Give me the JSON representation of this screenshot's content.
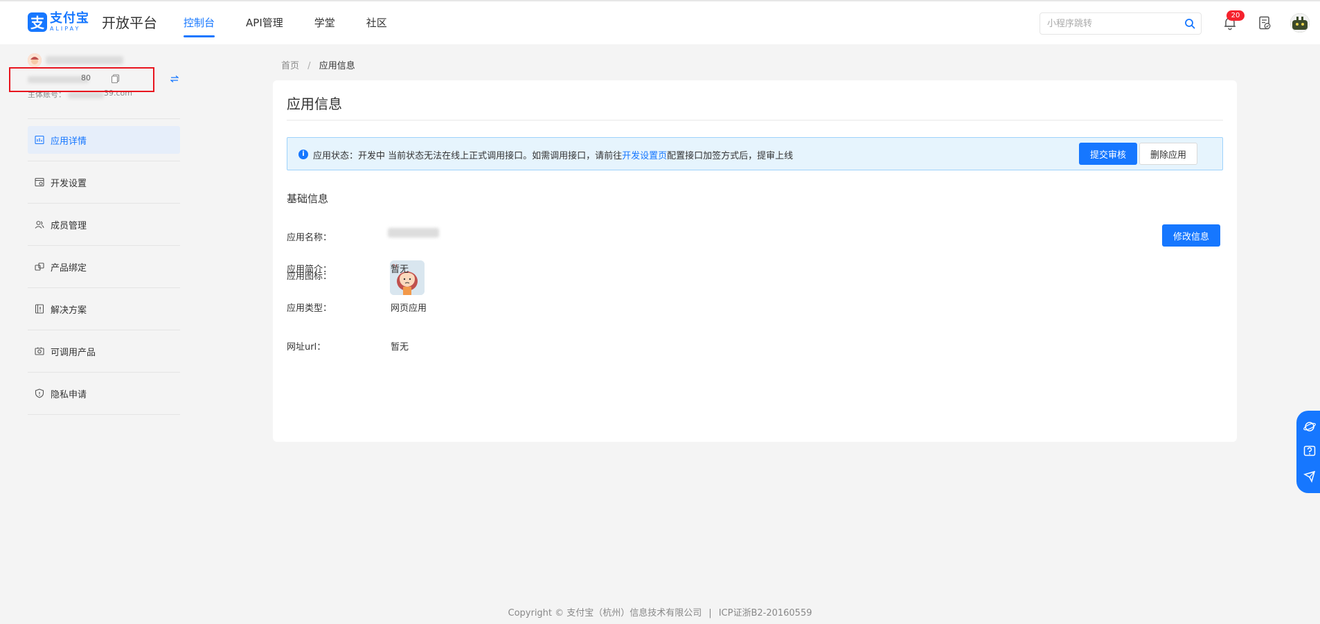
{
  "header": {
    "logo_cn": "支付宝",
    "logo_en": "ALIPAY",
    "platform_name": "开放平台",
    "nav": [
      {
        "label": "控制台",
        "active": true
      },
      {
        "label": "API管理",
        "active": false
      },
      {
        "label": "学堂",
        "active": false
      },
      {
        "label": "社区",
        "active": false
      }
    ],
    "search_placeholder": "小程序跳转",
    "notification_count": "20"
  },
  "sidebar": {
    "app_id_tail": "80",
    "owner_label": "主体账号：",
    "owner_tail": "39.com",
    "menu": [
      {
        "label": "应用详情",
        "icon": "app-detail-icon",
        "active": true
      },
      {
        "label": "开发设置",
        "icon": "dev-settings-icon",
        "active": false
      },
      {
        "label": "成员管理",
        "icon": "members-icon",
        "active": false
      },
      {
        "label": "产品绑定",
        "icon": "product-bind-icon",
        "active": false
      },
      {
        "label": "解决方案",
        "icon": "solution-icon",
        "active": false
      },
      {
        "label": "可调用产品",
        "icon": "callable-products-icon",
        "active": false
      },
      {
        "label": "隐私申请",
        "icon": "privacy-icon",
        "active": false
      }
    ]
  },
  "breadcrumb": {
    "home": "首页",
    "separator": "/",
    "current": "应用信息"
  },
  "card": {
    "title": "应用信息",
    "alert": {
      "prefix": "应用状态：开发中 当前状态无法在线上正式调用接口。如需调用接口，请前往",
      "link": "开发设置页",
      "suffix": "配置接口加签方式后，提审上线"
    },
    "submit_button": "提交审核",
    "delete_button": "删除应用",
    "section_title": "基础信息",
    "edit_button": "修改信息",
    "fields": {
      "name_label": "应用名称：",
      "icon_label": "应用图标：",
      "intro_label": "应用简介：",
      "intro_value": "暂无",
      "type_label": "应用类型：",
      "type_value": "网页应用",
      "url_label": "网址url：",
      "url_value": "暂无"
    }
  },
  "footer": {
    "copyright": "Copyright © 支付宝（杭州）信息技术有限公司",
    "separator": "|",
    "icp": "ICP证浙B2-20160559"
  },
  "colors": {
    "brand": "#1677ff",
    "alert_bg": "#e6f4fd",
    "badge": "#f5222d",
    "highlight_box": "#e8141e"
  }
}
